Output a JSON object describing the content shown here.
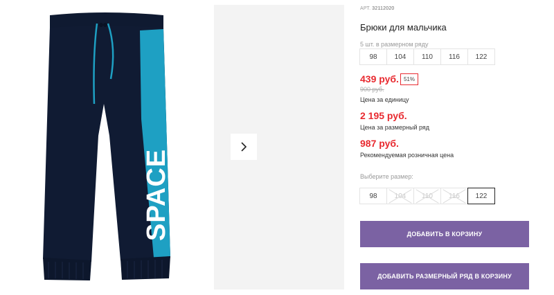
{
  "product": {
    "sku_label": "АРТ.",
    "sku": "32112020",
    "title": "Брюки для мальчика",
    "print_text": "SPACE"
  },
  "set_sizes": {
    "note": "5 шт. в размерном ряду",
    "sizes": [
      "98",
      "104",
      "110",
      "116",
      "122"
    ]
  },
  "prices": {
    "unit_price": "439 руб.",
    "discount": "51%",
    "old_price": "900 руб.",
    "unit_label": "Цена за единицу",
    "set_price": "2 195 руб.",
    "set_label": "Цена за размерный ряд",
    "retail_price": "987 руб.",
    "retail_label": "Рекомендуемая розничная цена"
  },
  "size_picker": {
    "label": "Выберите размер:",
    "options": [
      {
        "size": "98",
        "state": "available"
      },
      {
        "size": "104",
        "state": "disabled"
      },
      {
        "size": "110",
        "state": "disabled"
      },
      {
        "size": "116",
        "state": "disabled"
      },
      {
        "size": "122",
        "state": "selected"
      }
    ]
  },
  "actions": {
    "add_to_cart": "ДОБАВИТЬ В КОРЗИНУ",
    "add_set_to_cart": "ДОБАВИТЬ РАЗМЕРНЫЙ РЯД В КОРЗИНУ"
  },
  "colors": {
    "price_red": "#e8292f",
    "button_purple": "#7b62a3",
    "pants_navy": "#101b33",
    "stripe_teal": "#1ea0c3"
  },
  "icons": {
    "next": "chevron-right-icon"
  }
}
